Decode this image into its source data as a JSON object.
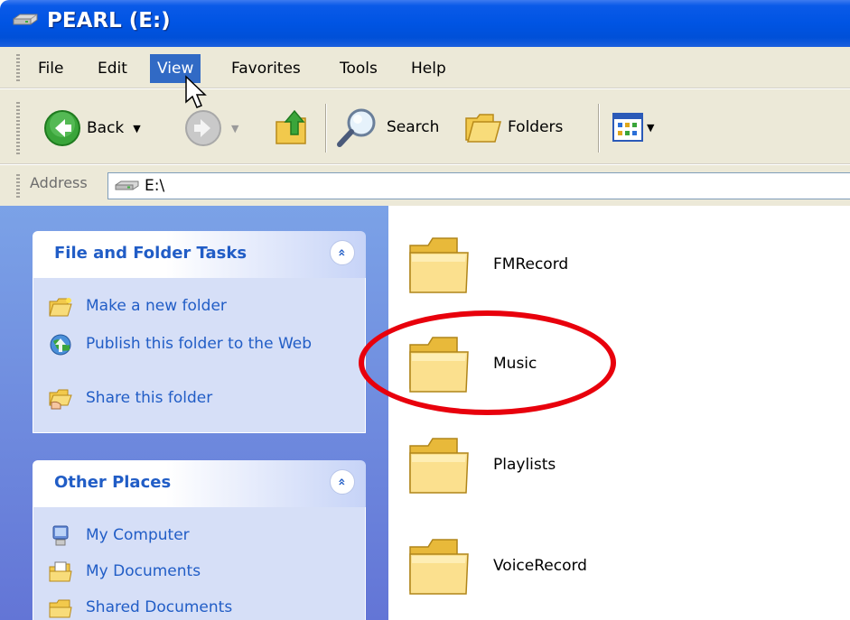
{
  "window": {
    "title": "PEARL (E:)"
  },
  "menu": [
    "File",
    "Edit",
    "View",
    "Favorites",
    "Tools",
    "Help"
  ],
  "active_menu": "View",
  "toolbar": {
    "back_label": "Back",
    "search_label": "Search",
    "folders_label": "Folders"
  },
  "address": {
    "label": "Address",
    "value": "E:\\"
  },
  "tasks_panel": {
    "title": "File and Folder Tasks",
    "collapse_glyph": "»",
    "items": [
      {
        "label": "Make a new folder",
        "icon": "new-folder-icon"
      },
      {
        "label": "Publish this folder to the Web",
        "icon": "publish-web-icon"
      },
      {
        "label": "Share this folder",
        "icon": "share-folder-icon"
      }
    ]
  },
  "places_panel": {
    "title": "Other Places",
    "collapse_glyph": "»",
    "items": [
      {
        "label": "My Computer",
        "icon": "my-computer-icon"
      },
      {
        "label": "My Documents",
        "icon": "my-documents-icon"
      },
      {
        "label": "Shared Documents",
        "icon": "shared-documents-icon"
      }
    ]
  },
  "folders": [
    "FMRecord",
    "Music",
    "Playlists",
    "VoiceRecord"
  ],
  "highlighted_folder": "Music",
  "colors": {
    "titlebar": "#0054e3",
    "menu_highlight": "#316ac5",
    "taskpane": "#7ba2e7",
    "link": "#215dc6",
    "annotation_ring": "#e8000c"
  }
}
